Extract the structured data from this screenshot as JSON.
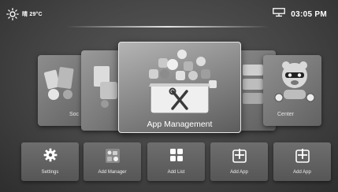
{
  "status": {
    "weather_text": "晴 29°C",
    "weather_icon": "sun-icon",
    "network_icon": "ethernet-icon",
    "time": "03:05 PM"
  },
  "carousel": {
    "items": [
      {
        "label": "Soc",
        "icon": "social-apps-icon"
      },
      {
        "label": "",
        "icon": "settings-apps-icon"
      },
      {
        "label": "App Management",
        "icon": "app-management-icon",
        "focused": true
      },
      {
        "label": "",
        "icon": "app-list-icon"
      },
      {
        "label": "Center",
        "icon": "game-center-icon"
      }
    ]
  },
  "dock": {
    "items": [
      {
        "label": "Settings",
        "icon": "gear-icon"
      },
      {
        "label": "Add Manager",
        "icon": "app-thumbnail-icon"
      },
      {
        "label": "Add List",
        "icon": "grid-icon"
      },
      {
        "label": "Add App",
        "icon": "add-app-icon"
      },
      {
        "label": "Add App",
        "icon": "add-app-icon"
      }
    ]
  },
  "colors": {
    "background": "#444444",
    "text": "#ffffff",
    "focus_border": "#e6e6e6"
  }
}
